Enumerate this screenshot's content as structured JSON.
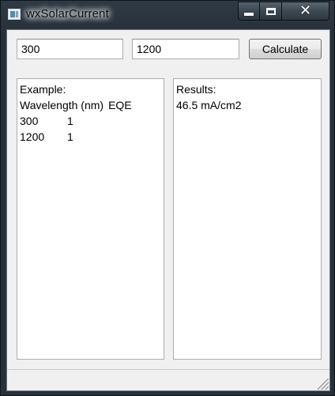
{
  "window": {
    "title": "wxSolarCurrent",
    "controls": {
      "minimize": "minimize",
      "maximize": "maximize",
      "close": "close"
    }
  },
  "toolbar": {
    "start_value": "300",
    "end_value": "1200",
    "calculate_label": "Calculate"
  },
  "input_panel": {
    "lines": [
      {
        "c1": "Example:",
        "c2": ""
      },
      {
        "c1": "Wavelength (nm)",
        "c2": "EQE"
      },
      {
        "c1": "300",
        "c2": "1"
      },
      {
        "c1": "1200",
        "c2": "1"
      }
    ]
  },
  "results_panel": {
    "heading": "Results:",
    "value": "46.5 mA/cm2"
  }
}
